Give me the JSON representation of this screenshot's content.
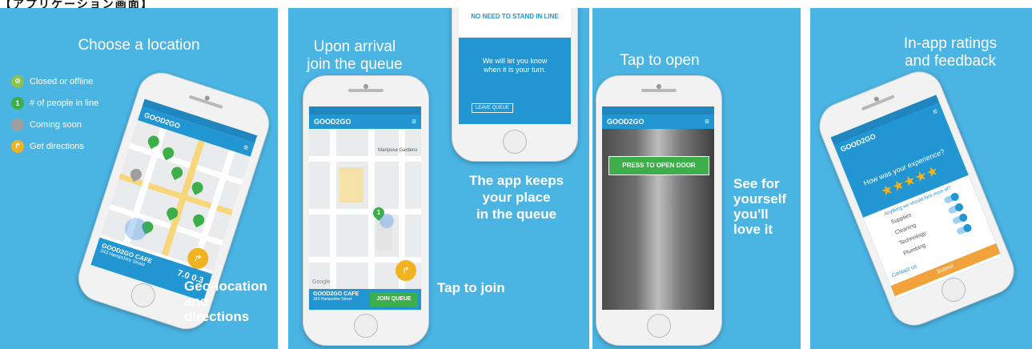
{
  "top_caption": "【アプリケーション画面】",
  "panel1": {
    "title": "Choose a location",
    "legend": [
      {
        "icon": "closed-icon",
        "label": "Closed or offline",
        "color": "#8bc34a"
      },
      {
        "icon": "people-in-line-icon",
        "label": "# of people in line",
        "color": "#3cae4a",
        "glyph": "1"
      },
      {
        "icon": "coming-soon-icon",
        "label": "Coming soon",
        "color": "#9e9e9e"
      },
      {
        "icon": "directions-icon",
        "label": "Get directions",
        "color": "#f2b320"
      }
    ],
    "callout": "Geo-location\nand\ndirections",
    "phone": {
      "brand": "GOOD2GO",
      "cafe_name": "GOOD2GO CAFE",
      "cafe_address": "343 Hampshire Street",
      "stats": [
        "7.0",
        "0.3"
      ],
      "stat_labels": [
        "Walk",
        "Mins",
        "Miles"
      ]
    }
  },
  "panel2": {
    "title": "Upon arrival\njoin the queue",
    "top_phone": {
      "heading": "NO NEED TO STAND IN LINE",
      "message": "We will let you know\nwhen it is your turn.",
      "leave_button": "LEAVE QUEUE"
    },
    "middle_text": "The app keeps\nyour place\nin the queue",
    "callout": "Tap to join",
    "phone": {
      "brand": "GOOD2GO",
      "map_label": "Mariposa Gardens",
      "pin_count": "1",
      "google_label": "Google",
      "cafe_name": "GOOD2GO CAFE",
      "cafe_address": "343 Hampshire Street",
      "join_button": "JOIN QUEUE"
    }
  },
  "panel3": {
    "title": "Tap to open",
    "callout": "See for\nyourself\nyou'll\nlove it",
    "phone": {
      "brand": "GOOD2GO",
      "open_button": "PRESS TO OPEN DOOR"
    }
  },
  "panel4": {
    "title": "In-app ratings\nand feedback",
    "phone": {
      "brand": "GOOD2GO",
      "question": "How was your experience?",
      "stars": 5,
      "prompt": "Anything we should fare more of?",
      "options": [
        "Supplies",
        "Cleaning",
        "Technology",
        "Plumbing"
      ],
      "contact": "Contact us",
      "submit": "Submit"
    }
  },
  "colors": {
    "panel_bg": "#4ab4e3",
    "brand_blue": "#2196d3",
    "green": "#3cae4a",
    "accent_orange": "#f2b320"
  }
}
